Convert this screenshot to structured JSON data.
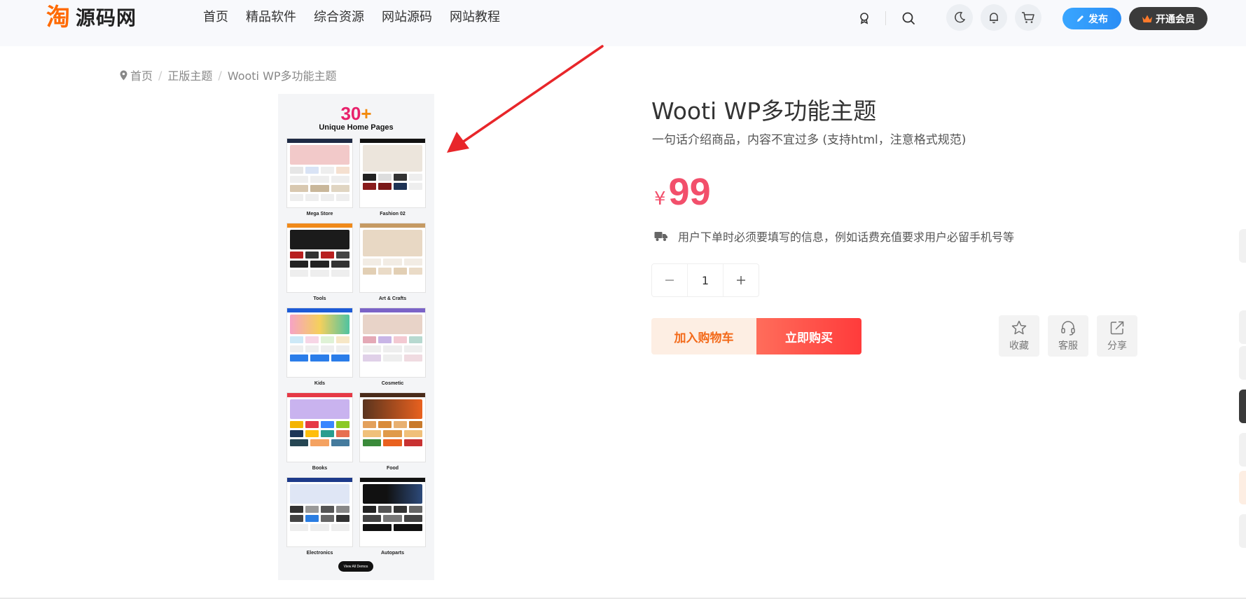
{
  "header": {
    "logo_text": "源码网",
    "logo_mark": "淘",
    "nav": [
      "首页",
      "精品软件",
      "综合资源",
      "网站源码",
      "网站教程"
    ],
    "publish_label": "发布",
    "vip_label": "开通会员"
  },
  "breadcrumb": {
    "items": [
      "首页",
      "正版主题",
      "Wooti WP多功能主题"
    ]
  },
  "product_image": {
    "big_number": "30",
    "plus": "+",
    "subtitle": "Unique Home Pages",
    "labels": [
      "Mega Store",
      "Fashion 02",
      "Tools",
      "Art & Crafts",
      "Kids",
      "Cosmetic",
      "Books",
      "Food",
      "Electronics",
      "Autoparts"
    ],
    "view_all": "View All Demos"
  },
  "product": {
    "title": "Wooti WP多功能主题",
    "desc": "一句话介绍商品，内容不宜过多 (支持html，注意格式规范)",
    "currency": "¥",
    "price": "99",
    "notice": "用户下单时必须要填写的信息，例如话费充值要求用户必留手机号等",
    "quantity": "1",
    "add_to_cart": "加入购物车",
    "buy_now": "立即购买",
    "actions": [
      "收藏",
      "客服",
      "分享"
    ]
  },
  "colors": {
    "price": "#f24f6b",
    "buy": "#ff3b3b",
    "cart_text": "#f36a1a",
    "publish": "#2a8df5",
    "arrow": "#e8262a"
  }
}
